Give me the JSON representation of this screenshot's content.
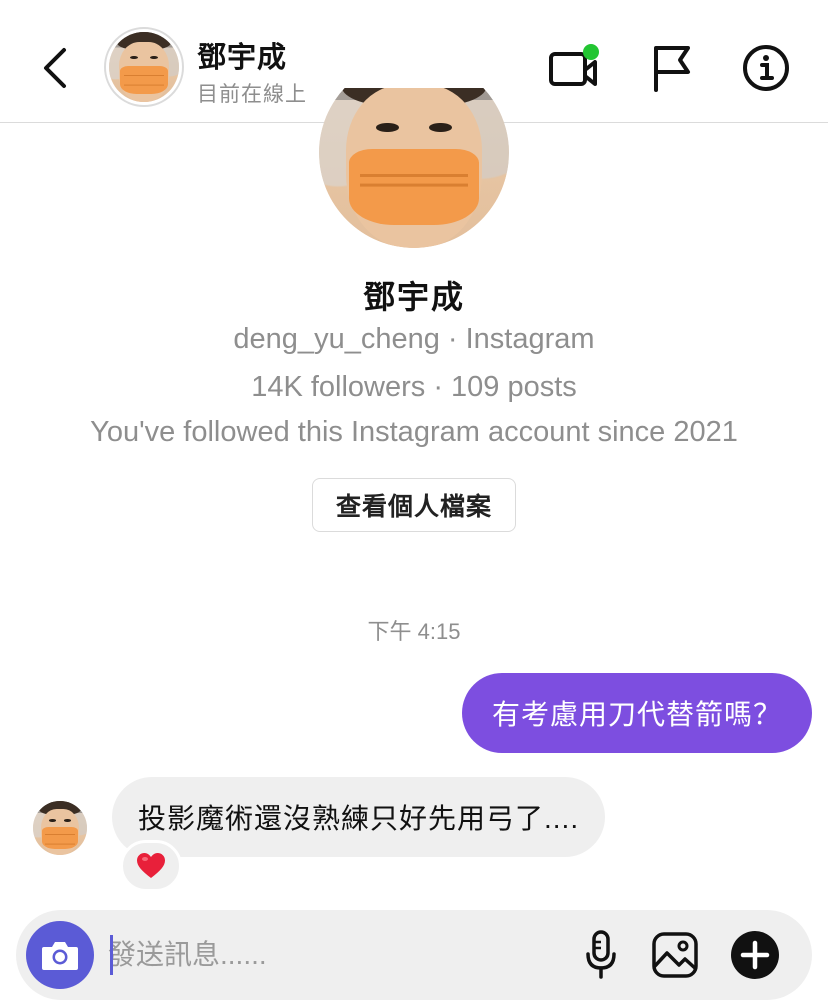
{
  "header": {
    "name": "鄧宇成",
    "status": "目前在線上"
  },
  "profile": {
    "name": "鄧宇成",
    "handle_line": "deng_yu_cheng · Instagram",
    "stats_line": "14K followers · 109 posts",
    "since_line": "You've followed this Instagram account since 2021",
    "view_profile_label": "查看個人檔案"
  },
  "messages": {
    "timestamp": "下午 4:15",
    "outgoing": "有考慮用刀代替箭嗎？",
    "incoming": "投影魔術還沒熟練只好先用弓了....",
    "reaction": "❤️"
  },
  "composer": {
    "placeholder": "發送訊息......"
  },
  "colors": {
    "accent": "#7d4ee0",
    "camera": "#5b5bd6",
    "online_dot": "#22c532",
    "muted_text": "#8e8e8e"
  },
  "icons": [
    "back-chevron-icon",
    "video-call-icon",
    "flag-icon",
    "info-icon",
    "camera-icon",
    "microphone-icon",
    "gallery-icon",
    "add-icon"
  ]
}
